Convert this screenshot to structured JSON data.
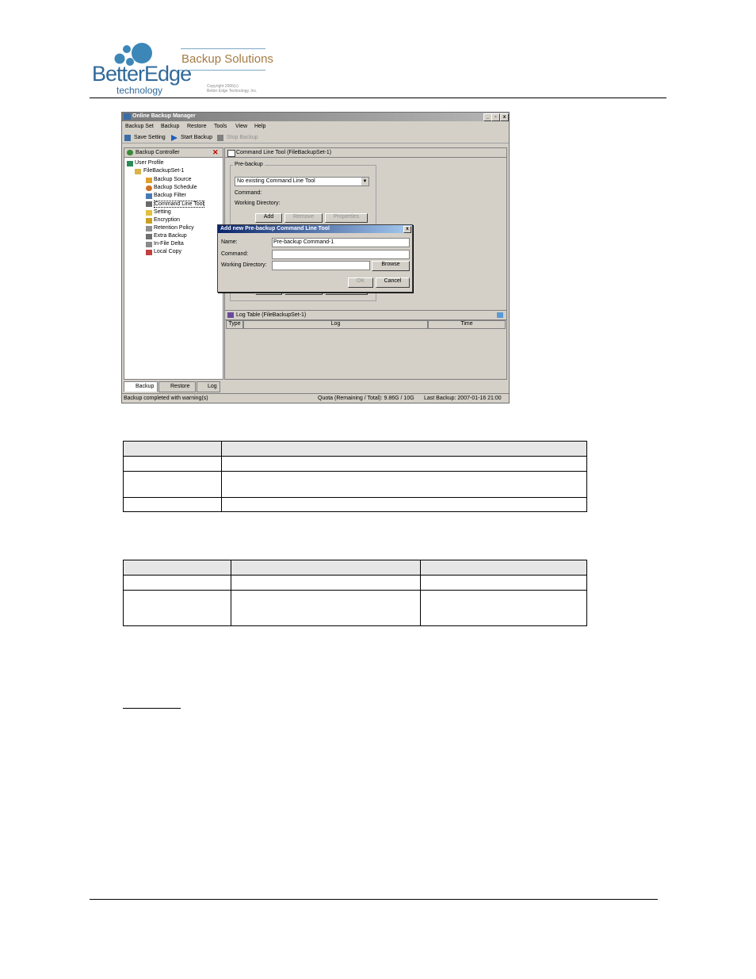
{
  "header": {
    "brand_name": "BetterEdge",
    "brand_sub": "technology",
    "tagline": "Backup Solutions",
    "copyright_line1": "Copyright 2006(c)",
    "copyright_line2": "Better Edge Technology, Inc."
  },
  "window": {
    "title": "Online Backup Manager",
    "controls": [
      "_",
      "▫",
      "x"
    ],
    "menu": [
      "Backup Set",
      "Backup",
      "Restore",
      "Tools",
      "View",
      "Help"
    ],
    "toolbar": {
      "save": "Save Setting",
      "start": "Start Backup",
      "stop": "Stop Backup"
    },
    "left_panel": {
      "title": "Backup Controller",
      "tree": [
        "User Profile",
        "FileBackupSet-1",
        "Backup Source",
        "Backup Schedule",
        "Backup Filter",
        "Command Line Tool",
        "Setting",
        "Encryption",
        "Retention Policy",
        "Extra Backup",
        "In-File Delta",
        "Local Copy"
      ]
    },
    "right_panel": {
      "title": "Command Line Tool (FileBackupSet-1)",
      "group_title": "Pre-backup",
      "combo_value": "No existing Command Line Tool",
      "command_label": "Command:",
      "working_dir_label": "Working Directory:",
      "add_label": "Add",
      "remove_label": "Remove",
      "properties_label": "Properties"
    },
    "dialog": {
      "title": "Add new Pre-backup Command Line Tool",
      "name_label": "Name:",
      "name_value": "Pre-backup Command-1",
      "command_label": "Command:",
      "working_dir_label": "Working Directory:",
      "browse_label": "Browse",
      "ok_label": "OK",
      "cancel_label": "Cancel"
    },
    "log": {
      "title": "Log Table (FileBackupSet-1)",
      "columns": [
        "Type",
        "Log",
        "Time"
      ]
    },
    "tabs": [
      "Backup",
      "Restore",
      "Log"
    ],
    "status": {
      "left": "Backup completed with warning(s)",
      "quota": "Quota (Remaining / Total): 9.86G / 10G",
      "last_backup": "Last Backup: 2007-01-16 21:00"
    }
  },
  "colors": {
    "brand_blue": "#31699a",
    "tagline_gold": "#a47b45",
    "window_face": "#d4d0c8",
    "dialog_title": "#0a246a"
  }
}
